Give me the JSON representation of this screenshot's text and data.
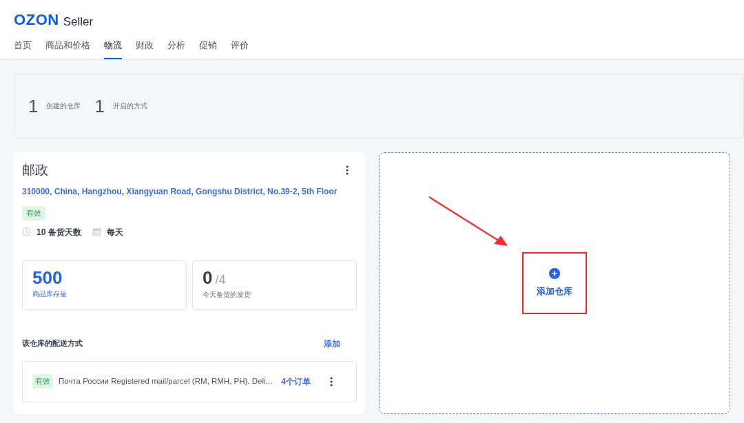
{
  "header": {
    "logo": "OZON",
    "product": "Seller"
  },
  "tabs": [
    {
      "label": "首页",
      "selected": false
    },
    {
      "label": "商品和价格",
      "selected": false
    },
    {
      "label": "物流",
      "selected": true
    },
    {
      "label": "财政",
      "selected": false
    },
    {
      "label": "分析",
      "selected": false
    },
    {
      "label": "促销",
      "selected": false
    },
    {
      "label": "评价",
      "selected": false
    }
  ],
  "summary": [
    {
      "value": "1",
      "label": "创建的仓库"
    },
    {
      "value": "1",
      "label": "开启的方式"
    }
  ],
  "warehouse": {
    "name": "邮政",
    "address": "310000, China, Hangzhou, Xiangyuan Road, Gongshu District, No.39-2, 5th Floor",
    "status": "有效",
    "prep_days": "10 备货天数",
    "schedule": "每天",
    "stats": [
      {
        "value": "500",
        "label": "商品库存量",
        "kind": "accent"
      },
      {
        "value": "0",
        "total": "/4",
        "label": "今天备货的发货",
        "kind": "plain"
      }
    ],
    "delivery_title": "该仓库的配送方式",
    "add_link": "添加",
    "methods": [
      {
        "status": "有效",
        "name": "Почта России Registered mail/parcel (RM, RMH, PH). Deli...",
        "orders": "4个订单"
      }
    ]
  },
  "add_warehouse": {
    "label": "添加仓库",
    "highlighted": true
  }
}
